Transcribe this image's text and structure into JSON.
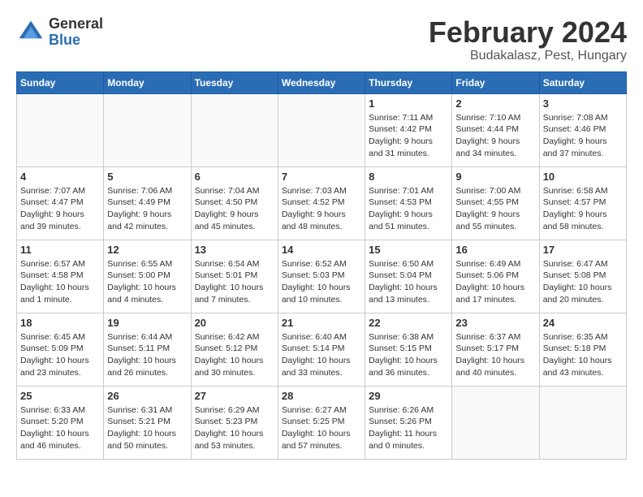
{
  "logo": {
    "general": "General",
    "blue": "Blue"
  },
  "title": "February 2024",
  "subtitle": "Budakalasz, Pest, Hungary",
  "days_of_week": [
    "Sunday",
    "Monday",
    "Tuesday",
    "Wednesday",
    "Thursday",
    "Friday",
    "Saturday"
  ],
  "weeks": [
    [
      {
        "day": "",
        "info": ""
      },
      {
        "day": "",
        "info": ""
      },
      {
        "day": "",
        "info": ""
      },
      {
        "day": "",
        "info": ""
      },
      {
        "day": "1",
        "info": "Sunrise: 7:11 AM\nSunset: 4:42 PM\nDaylight: 9 hours and 31 minutes."
      },
      {
        "day": "2",
        "info": "Sunrise: 7:10 AM\nSunset: 4:44 PM\nDaylight: 9 hours and 34 minutes."
      },
      {
        "day": "3",
        "info": "Sunrise: 7:08 AM\nSunset: 4:46 PM\nDaylight: 9 hours and 37 minutes."
      }
    ],
    [
      {
        "day": "4",
        "info": "Sunrise: 7:07 AM\nSunset: 4:47 PM\nDaylight: 9 hours and 39 minutes."
      },
      {
        "day": "5",
        "info": "Sunrise: 7:06 AM\nSunset: 4:49 PM\nDaylight: 9 hours and 42 minutes."
      },
      {
        "day": "6",
        "info": "Sunrise: 7:04 AM\nSunset: 4:50 PM\nDaylight: 9 hours and 45 minutes."
      },
      {
        "day": "7",
        "info": "Sunrise: 7:03 AM\nSunset: 4:52 PM\nDaylight: 9 hours and 48 minutes."
      },
      {
        "day": "8",
        "info": "Sunrise: 7:01 AM\nSunset: 4:53 PM\nDaylight: 9 hours and 51 minutes."
      },
      {
        "day": "9",
        "info": "Sunrise: 7:00 AM\nSunset: 4:55 PM\nDaylight: 9 hours and 55 minutes."
      },
      {
        "day": "10",
        "info": "Sunrise: 6:58 AM\nSunset: 4:57 PM\nDaylight: 9 hours and 58 minutes."
      }
    ],
    [
      {
        "day": "11",
        "info": "Sunrise: 6:57 AM\nSunset: 4:58 PM\nDaylight: 10 hours and 1 minute."
      },
      {
        "day": "12",
        "info": "Sunrise: 6:55 AM\nSunset: 5:00 PM\nDaylight: 10 hours and 4 minutes."
      },
      {
        "day": "13",
        "info": "Sunrise: 6:54 AM\nSunset: 5:01 PM\nDaylight: 10 hours and 7 minutes."
      },
      {
        "day": "14",
        "info": "Sunrise: 6:52 AM\nSunset: 5:03 PM\nDaylight: 10 hours and 10 minutes."
      },
      {
        "day": "15",
        "info": "Sunrise: 6:50 AM\nSunset: 5:04 PM\nDaylight: 10 hours and 13 minutes."
      },
      {
        "day": "16",
        "info": "Sunrise: 6:49 AM\nSunset: 5:06 PM\nDaylight: 10 hours and 17 minutes."
      },
      {
        "day": "17",
        "info": "Sunrise: 6:47 AM\nSunset: 5:08 PM\nDaylight: 10 hours and 20 minutes."
      }
    ],
    [
      {
        "day": "18",
        "info": "Sunrise: 6:45 AM\nSunset: 5:09 PM\nDaylight: 10 hours and 23 minutes."
      },
      {
        "day": "19",
        "info": "Sunrise: 6:44 AM\nSunset: 5:11 PM\nDaylight: 10 hours and 26 minutes."
      },
      {
        "day": "20",
        "info": "Sunrise: 6:42 AM\nSunset: 5:12 PM\nDaylight: 10 hours and 30 minutes."
      },
      {
        "day": "21",
        "info": "Sunrise: 6:40 AM\nSunset: 5:14 PM\nDaylight: 10 hours and 33 minutes."
      },
      {
        "day": "22",
        "info": "Sunrise: 6:38 AM\nSunset: 5:15 PM\nDaylight: 10 hours and 36 minutes."
      },
      {
        "day": "23",
        "info": "Sunrise: 6:37 AM\nSunset: 5:17 PM\nDaylight: 10 hours and 40 minutes."
      },
      {
        "day": "24",
        "info": "Sunrise: 6:35 AM\nSunset: 5:18 PM\nDaylight: 10 hours and 43 minutes."
      }
    ],
    [
      {
        "day": "25",
        "info": "Sunrise: 6:33 AM\nSunset: 5:20 PM\nDaylight: 10 hours and 46 minutes."
      },
      {
        "day": "26",
        "info": "Sunrise: 6:31 AM\nSunset: 5:21 PM\nDaylight: 10 hours and 50 minutes."
      },
      {
        "day": "27",
        "info": "Sunrise: 6:29 AM\nSunset: 5:23 PM\nDaylight: 10 hours and 53 minutes."
      },
      {
        "day": "28",
        "info": "Sunrise: 6:27 AM\nSunset: 5:25 PM\nDaylight: 10 hours and 57 minutes."
      },
      {
        "day": "29",
        "info": "Sunrise: 6:26 AM\nSunset: 5:26 PM\nDaylight: 11 hours and 0 minutes."
      },
      {
        "day": "",
        "info": ""
      },
      {
        "day": "",
        "info": ""
      }
    ]
  ]
}
